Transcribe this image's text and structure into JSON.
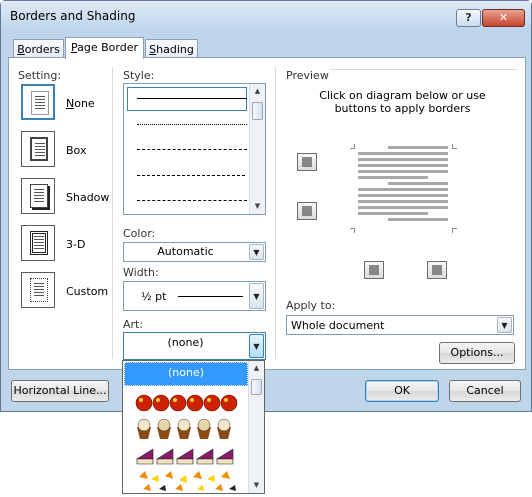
{
  "window": {
    "title": "Borders and Shading",
    "help_glyph": "?",
    "close_glyph": "✕"
  },
  "tabs": [
    {
      "label": "Borders",
      "accel": "B",
      "rest": "orders"
    },
    {
      "label": "Page Border",
      "accel": "P",
      "rest": "age Border"
    },
    {
      "label": "Shading",
      "accel": "S",
      "rest": "hading"
    }
  ],
  "setting": {
    "label": "Setting:",
    "options": [
      {
        "label": "None",
        "accel": "N",
        "rest": "one",
        "selected": true
      },
      {
        "label": "Box",
        "accel": "x",
        "selected": false
      },
      {
        "label": "Shadow",
        "accel": "a",
        "selected": false
      },
      {
        "label": "3-D",
        "accel": "D",
        "selected": false
      },
      {
        "label": "Custom",
        "accel": "u",
        "selected": false
      }
    ]
  },
  "style": {
    "label": "Style:",
    "accel": "y",
    "selected_index": 0
  },
  "color": {
    "label": "Color:",
    "accel": "C",
    "value": "Automatic"
  },
  "width": {
    "label": "Width:",
    "accel": "W",
    "value": "½ pt"
  },
  "art": {
    "label": "Art:",
    "accel": "r",
    "value": "(none)",
    "dropdown_selected": "(none)"
  },
  "preview": {
    "label": "Preview",
    "instructions_line1": "Click on diagram below or use",
    "instructions_line2": "buttons to apply borders"
  },
  "apply_to": {
    "label": "Apply to:",
    "accel": "l",
    "value": "Whole document"
  },
  "buttons": {
    "options": "Options...",
    "horizontal_line": "Horizontal Line...",
    "ok": "OK",
    "cancel": "Cancel"
  },
  "icons": {
    "dropdown": "▼",
    "scroll_up": "▲",
    "scroll_down": "▼"
  },
  "colors": {
    "dialog_bg": "#bfd5ea",
    "selection_blue": "#3399ff",
    "focus_border": "#3c7fb1"
  }
}
